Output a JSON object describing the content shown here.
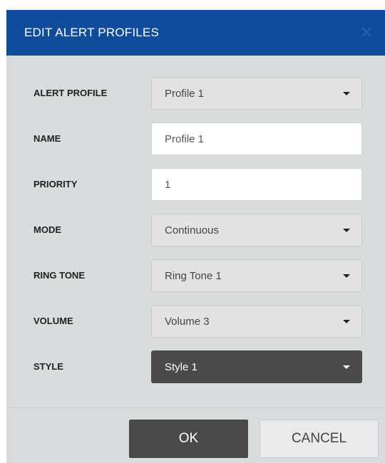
{
  "dialog": {
    "title": "EDIT ALERT PROFILES",
    "close_icon": "close-icon"
  },
  "fields": [
    {
      "label": "ALERT PROFILE",
      "value": "Profile 1",
      "type": "select"
    },
    {
      "label": "NAME",
      "value": "Profile 1",
      "type": "input"
    },
    {
      "label": "PRIORITY",
      "value": "1",
      "type": "input"
    },
    {
      "label": "MODE",
      "value": "Continuous",
      "type": "select"
    },
    {
      "label": "RING TONE",
      "value": "Ring Tone 1",
      "type": "select"
    },
    {
      "label": "VOLUME",
      "value": "Volume 3",
      "type": "select"
    },
    {
      "label": "STYLE",
      "value": "Style 1",
      "type": "select",
      "state": "focused"
    }
  ],
  "buttons": {
    "ok": "OK",
    "cancel": "CANCEL"
  },
  "colors": {
    "header": "#0f4d9c",
    "body": "#d9dcdc",
    "dark_control": "#4a4a4a"
  }
}
